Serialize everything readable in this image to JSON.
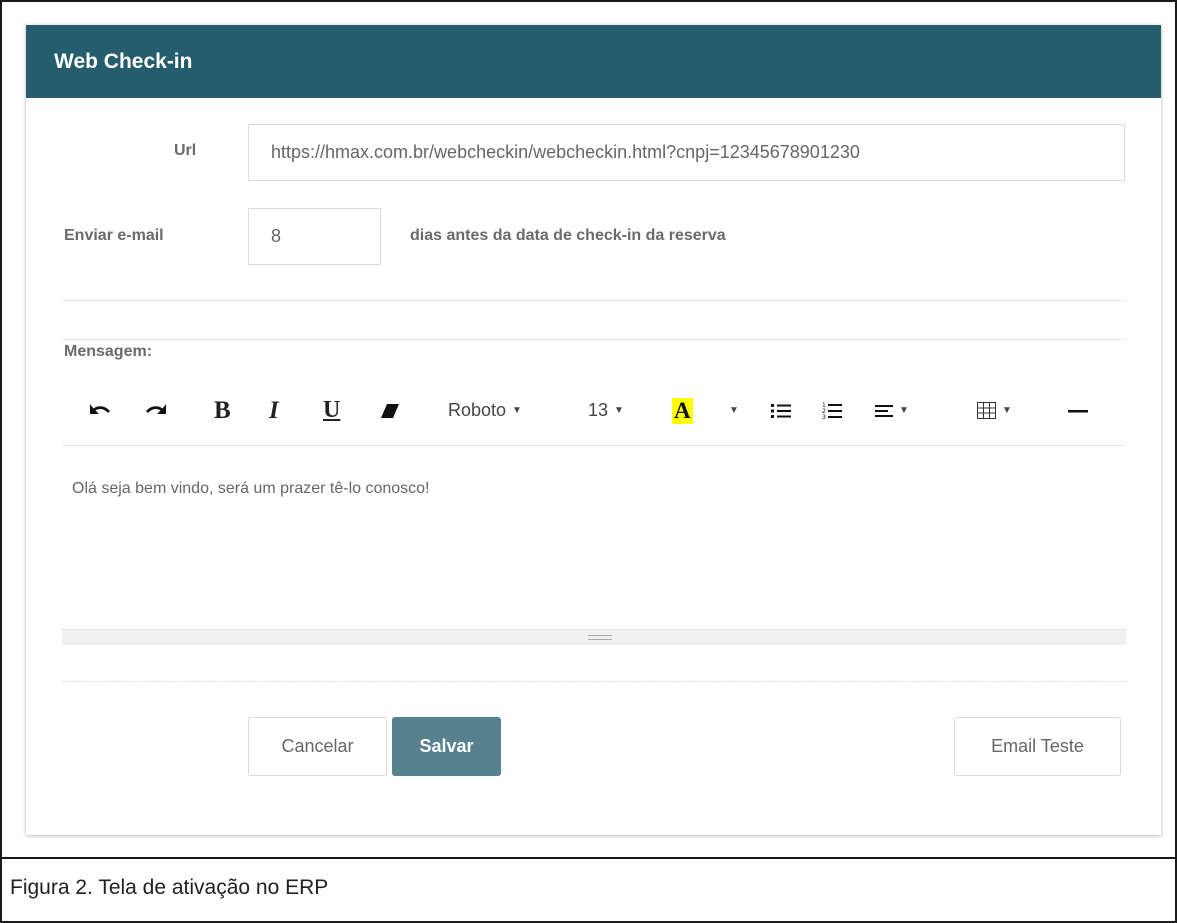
{
  "panel": {
    "title": "Web Check-in"
  },
  "url_field": {
    "label": "Url",
    "value": "https://hmax.com.br/webcheckin/webcheckin.html?cnpj=12345678901230"
  },
  "email_field": {
    "label": "Enviar e-mail",
    "value": "8",
    "suffix": "dias antes da data de check-in da reserva"
  },
  "message": {
    "label": "Mensagem:",
    "toolbar": {
      "undo_icon": "undo-icon",
      "redo_icon": "redo-icon",
      "bold": "B",
      "italic": "I",
      "underline": "U",
      "eraser_icon": "eraser-icon",
      "font_name": "Roboto",
      "font_size": "13",
      "color": "A",
      "highlight_color": "#ffff00",
      "unordered_list_icon": "unordered-list-icon",
      "ordered_list_icon": "ordered-list-icon",
      "align_icon": "align-icon",
      "table_icon": "table-icon",
      "hr_icon": "horizontal-rule-icon"
    },
    "body": "Olá seja bem vindo, será um prazer tê-lo conosco!"
  },
  "buttons": {
    "cancel": "Cancelar",
    "save": "Salvar",
    "test_email": "Email Teste"
  },
  "caption": "Figura 2. Tela de ativação no ERP",
  "colors": {
    "header": "#255d6e",
    "primary_button": "#57818f"
  }
}
